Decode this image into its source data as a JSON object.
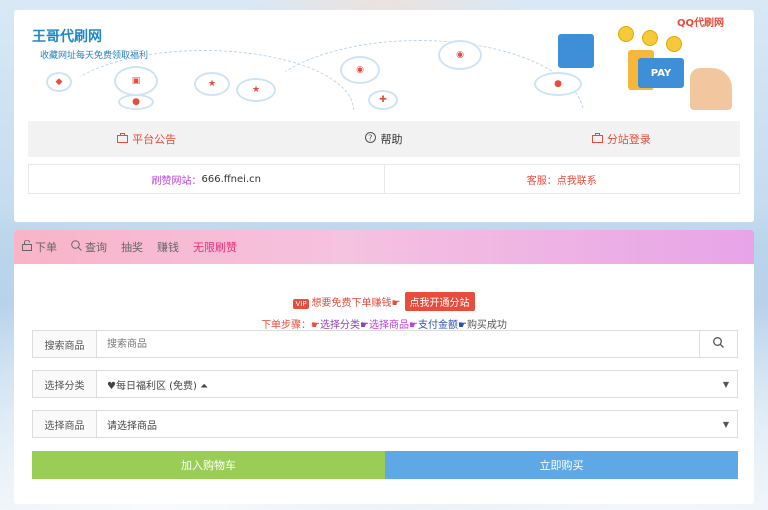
{
  "brand": {
    "title": "王哥代刷网",
    "subtitle": "收藏网址每天免费领取福利",
    "logo_text": "QQ代刷网",
    "pay_text": "PAY"
  },
  "nav": {
    "announcement": "平台公告",
    "help": "帮助",
    "substation_login": "分站登录"
  },
  "info": {
    "site_label": "刷赞网站：",
    "site_value": "666.ffnei.cn",
    "service_label": "客服：",
    "service_value": "点我联系"
  },
  "tabs": {
    "order": "下单",
    "query": "查询",
    "lottery": "抽奖",
    "earn": "赚钱",
    "unlimited": "无限刷赞"
  },
  "promo": {
    "vip_badge": "VIP",
    "text": "想要免费下单赚钱",
    "button": "点我开通分站"
  },
  "steps": {
    "prefix": "下单步骤：",
    "step1": "选择分类",
    "step2": "选择商品",
    "step3": "支付金额",
    "step4": "购买成功"
  },
  "form": {
    "search_label": "搜索商品",
    "search_placeholder": "搜索商品",
    "category_label": "选择分类",
    "category_value": "♥每日福利区 (免费) ⏶",
    "product_label": "选择商品",
    "product_value": "请选择商品"
  },
  "buttons": {
    "add_cart": "加入购物车",
    "buy_now": "立即购买"
  },
  "colors": {
    "accent_red": "#e74c3c",
    "green_btn": "#9acd55",
    "blue_btn": "#5ea8e6",
    "brand_blue": "#1e88c8"
  }
}
